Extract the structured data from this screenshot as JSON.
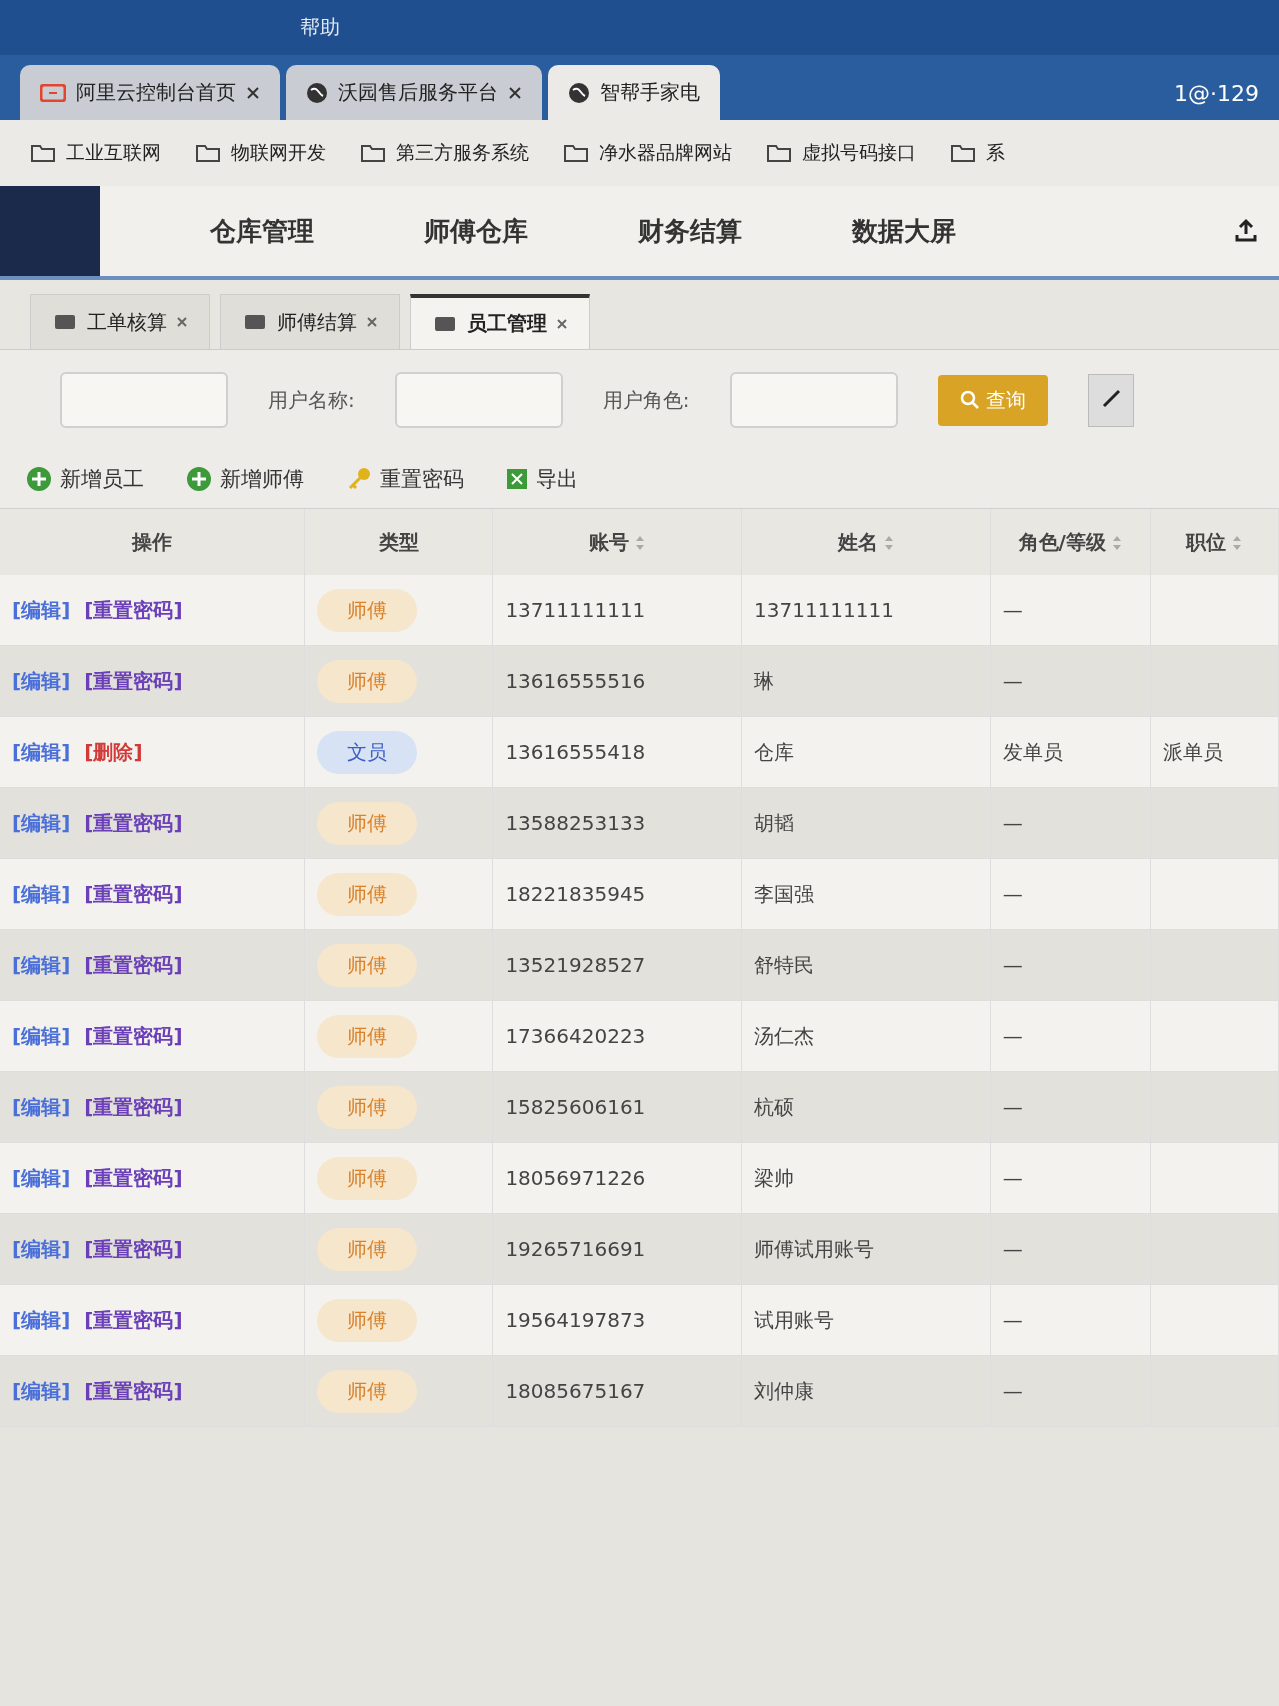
{
  "menu_bar": {
    "items": [
      "帮助"
    ]
  },
  "browser_tabs": [
    {
      "label": "阿里云控制台首页",
      "kind": "cloud",
      "selected": false
    },
    {
      "label": "沃园售后服务平台",
      "kind": "site",
      "selected": false
    },
    {
      "label": "智帮手家电",
      "kind": "site",
      "selected": true
    }
  ],
  "account": {
    "label": "1@·129"
  },
  "bookmarks": [
    "工业互联网",
    "物联网开发",
    "第三方服务系统",
    "净水器品牌网站",
    "虚拟号码接口",
    "系"
  ],
  "top_nav": [
    "仓库管理",
    "师傅仓库",
    "财务结算",
    "数据大屏"
  ],
  "page_tabs": [
    {
      "label": "工单核算",
      "selected": false
    },
    {
      "label": "师傅结算",
      "selected": false
    },
    {
      "label": "员工管理",
      "selected": true
    }
  ],
  "filters": [
    {
      "label": "用户名称:"
    },
    {
      "label": "用户角色:"
    }
  ],
  "search_button": "查询",
  "toolbar": [
    {
      "label": "新增员工",
      "kind": "add"
    },
    {
      "label": "新增师傅",
      "kind": "add"
    },
    {
      "label": "重置密码",
      "kind": "key"
    },
    {
      "label": "导出",
      "kind": "export"
    }
  ],
  "table": {
    "columns": [
      {
        "label": "操作",
        "sortable": false
      },
      {
        "label": "类型",
        "sortable": false
      },
      {
        "label": "账号",
        "sortable": true
      },
      {
        "label": "姓名",
        "sortable": true
      },
      {
        "label": "角色/等级",
        "sortable": true
      },
      {
        "label": "职位",
        "sortable": true
      }
    ],
    "rows": [
      {
        "actions": [
          {
            "label": "[编辑]",
            "kind": "edit"
          },
          {
            "label": "[重置密码]",
            "kind": "reset"
          }
        ],
        "type": {
          "label": "师傅",
          "kind": "master"
        },
        "account": "13711111111",
        "name": "13711111111",
        "role": "—"
      },
      {
        "actions": [
          {
            "label": "[编辑]",
            "kind": "edit"
          },
          {
            "label": "[重置密码]",
            "kind": "reset"
          }
        ],
        "type": {
          "label": "师傅",
          "kind": "master"
        },
        "account": "13616555516",
        "name": "琳",
        "role": "—"
      },
      {
        "actions": [
          {
            "label": "[编辑]",
            "kind": "edit"
          },
          {
            "label": "[删除]",
            "kind": "delete"
          }
        ],
        "type": {
          "label": "文员",
          "kind": "clerk"
        },
        "account": "13616555418",
        "name": "仓库",
        "role": "发单员",
        "position": "派单员"
      },
      {
        "actions": [
          {
            "label": "[编辑]",
            "kind": "edit"
          },
          {
            "label": "[重置密码]",
            "kind": "reset"
          }
        ],
        "type": {
          "label": "师傅",
          "kind": "master"
        },
        "account": "13588253133",
        "name": "胡韬",
        "role": "—"
      },
      {
        "actions": [
          {
            "label": "[编辑]",
            "kind": "edit"
          },
          {
            "label": "[重置密码]",
            "kind": "reset"
          }
        ],
        "type": {
          "label": "师傅",
          "kind": "master"
        },
        "account": "18221835945",
        "name": "李国强",
        "role": "—"
      },
      {
        "actions": [
          {
            "label": "[编辑]",
            "kind": "edit"
          },
          {
            "label": "[重置密码]",
            "kind": "reset"
          }
        ],
        "type": {
          "label": "师傅",
          "kind": "master"
        },
        "account": "13521928527",
        "name": "舒特民",
        "role": "—"
      },
      {
        "actions": [
          {
            "label": "[编辑]",
            "kind": "edit"
          },
          {
            "label": "[重置密码]",
            "kind": "reset"
          }
        ],
        "type": {
          "label": "师傅",
          "kind": "master"
        },
        "account": "17366420223",
        "name": "汤仁杰",
        "role": "—"
      },
      {
        "actions": [
          {
            "label": "[编辑]",
            "kind": "edit"
          },
          {
            "label": "[重置密码]",
            "kind": "reset"
          }
        ],
        "type": {
          "label": "师傅",
          "kind": "master"
        },
        "account": "15825606161",
        "name": "杭硕",
        "role": "—"
      },
      {
        "actions": [
          {
            "label": "[编辑]",
            "kind": "edit"
          },
          {
            "label": "[重置密码]",
            "kind": "reset"
          }
        ],
        "type": {
          "label": "师傅",
          "kind": "master"
        },
        "account": "18056971226",
        "name": "梁帅",
        "role": "—"
      },
      {
        "actions": [
          {
            "label": "[编辑]",
            "kind": "edit"
          },
          {
            "label": "[重置密码]",
            "kind": "reset"
          }
        ],
        "type": {
          "label": "师傅",
          "kind": "master"
        },
        "account": "19265716691",
        "name": "师傅试用账号",
        "role": "—"
      },
      {
        "actions": [
          {
            "label": "[编辑]",
            "kind": "edit"
          },
          {
            "label": "[重置密码]",
            "kind": "reset"
          }
        ],
        "type": {
          "label": "师傅",
          "kind": "master"
        },
        "account": "19564197873",
        "name": "试用账号",
        "role": "—"
      },
      {
        "actions": [
          {
            "label": "[编辑]",
            "kind": "edit"
          },
          {
            "label": "[重置密码]",
            "kind": "reset"
          }
        ],
        "type": {
          "label": "师傅",
          "kind": "master"
        },
        "account": "18085675167",
        "name": "刘仲康",
        "role": "—"
      }
    ]
  }
}
